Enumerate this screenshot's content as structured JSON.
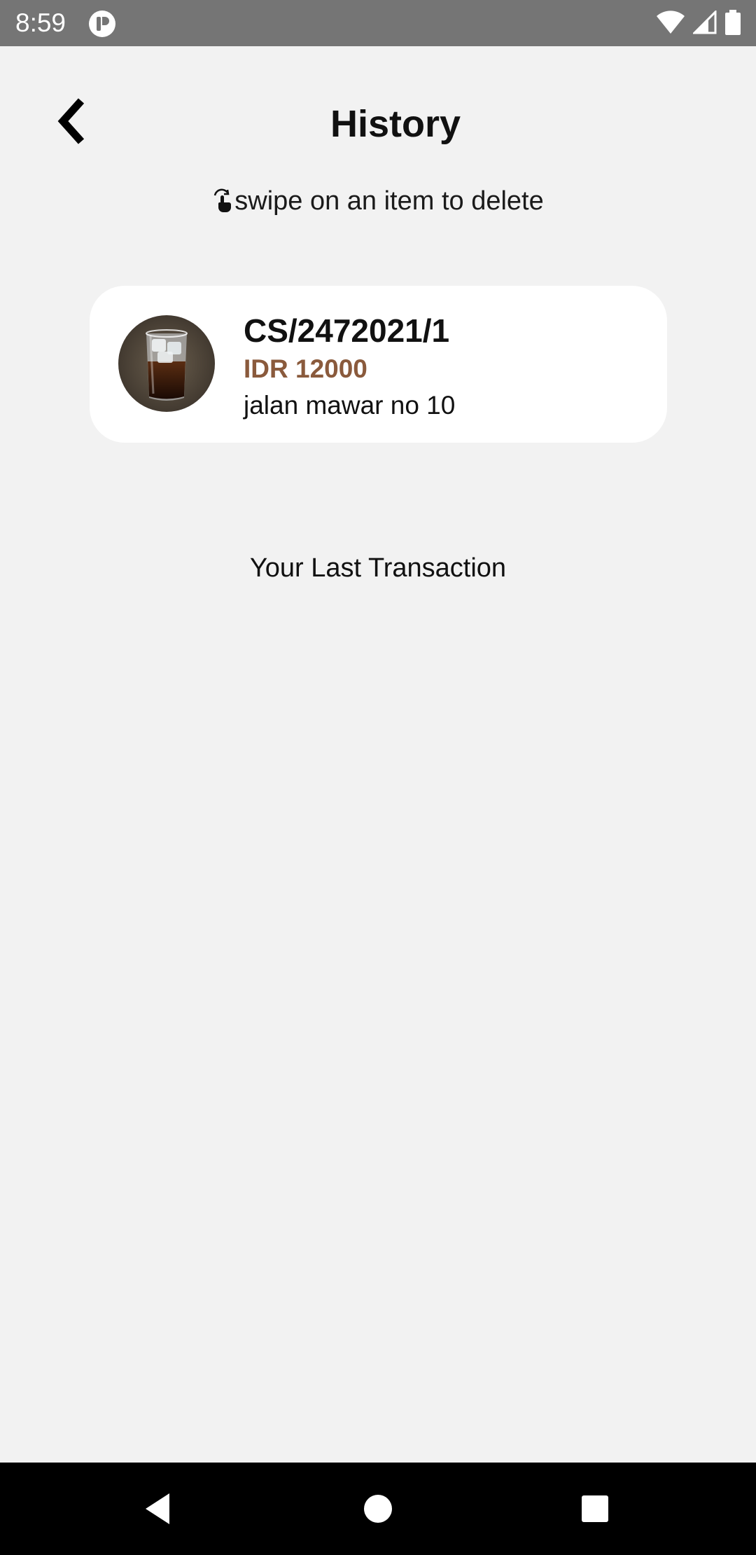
{
  "status_bar": {
    "time": "8:59",
    "app_icon": "notification-app-icon",
    "icons": [
      "wifi-icon",
      "cell-signal-icon",
      "battery-icon"
    ]
  },
  "header": {
    "title": "History",
    "back_icon": "chevron-left-icon"
  },
  "hint": {
    "icon": "swipe-hand-icon",
    "text": "swipe on an item to delete"
  },
  "history": {
    "items": [
      {
        "code": "CS/2472021/1",
        "price": "IDR 12000",
        "address": "jalan mawar no 10",
        "image": "iced-coffee-glass"
      }
    ]
  },
  "footer": {
    "label": "Your Last Transaction"
  },
  "nav_bar": {
    "buttons": [
      "nav-back-icon",
      "nav-home-icon",
      "nav-recents-icon"
    ]
  },
  "colors": {
    "background": "#f2f2f2",
    "status_bar": "#757575",
    "card": "#ffffff",
    "price": "#8a5a3c",
    "nav_bar": "#000000"
  }
}
